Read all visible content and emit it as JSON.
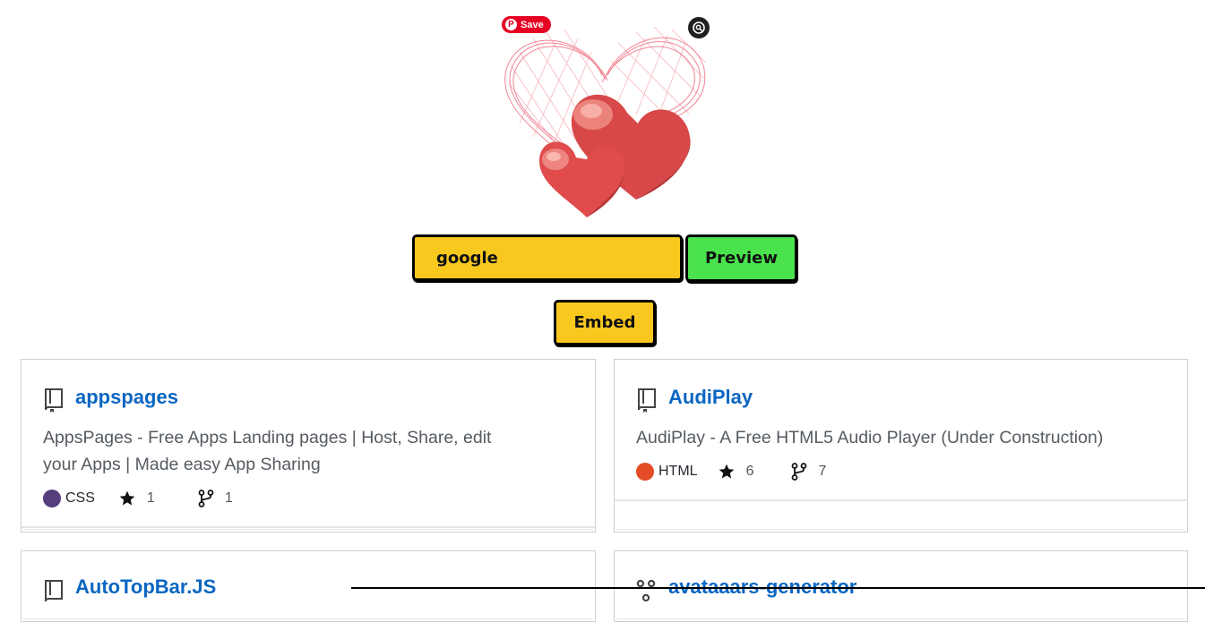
{
  "pin_save": {
    "label": "Save",
    "logo": "P"
  },
  "lens_icon": "visual-search-icon",
  "search": {
    "value": "google"
  },
  "buttons": {
    "preview": "Preview",
    "embed": "Embed"
  },
  "colors": {
    "input": "#f9c81f",
    "preview": "#4ae24d",
    "link": "#0a66c2",
    "css": "#563d7c",
    "html": "#e34c26"
  },
  "repos": [
    {
      "name": "appspages",
      "description_line1": "AppsPages - Free Apps Landing pages | Host, Share, edit",
      "description_line2": "your Apps | Made easy App Sharing",
      "language": "CSS",
      "stars": "1",
      "forks": "1"
    },
    {
      "name": "AudiPlay",
      "description_line1": "AudiPlay - A Free HTML5 Audio Player (Under Construction)",
      "language": "HTML",
      "stars": "6",
      "forks": "7"
    },
    {
      "name": "AutoTopBar.JS"
    },
    {
      "name": "avataaars-generator"
    }
  ]
}
